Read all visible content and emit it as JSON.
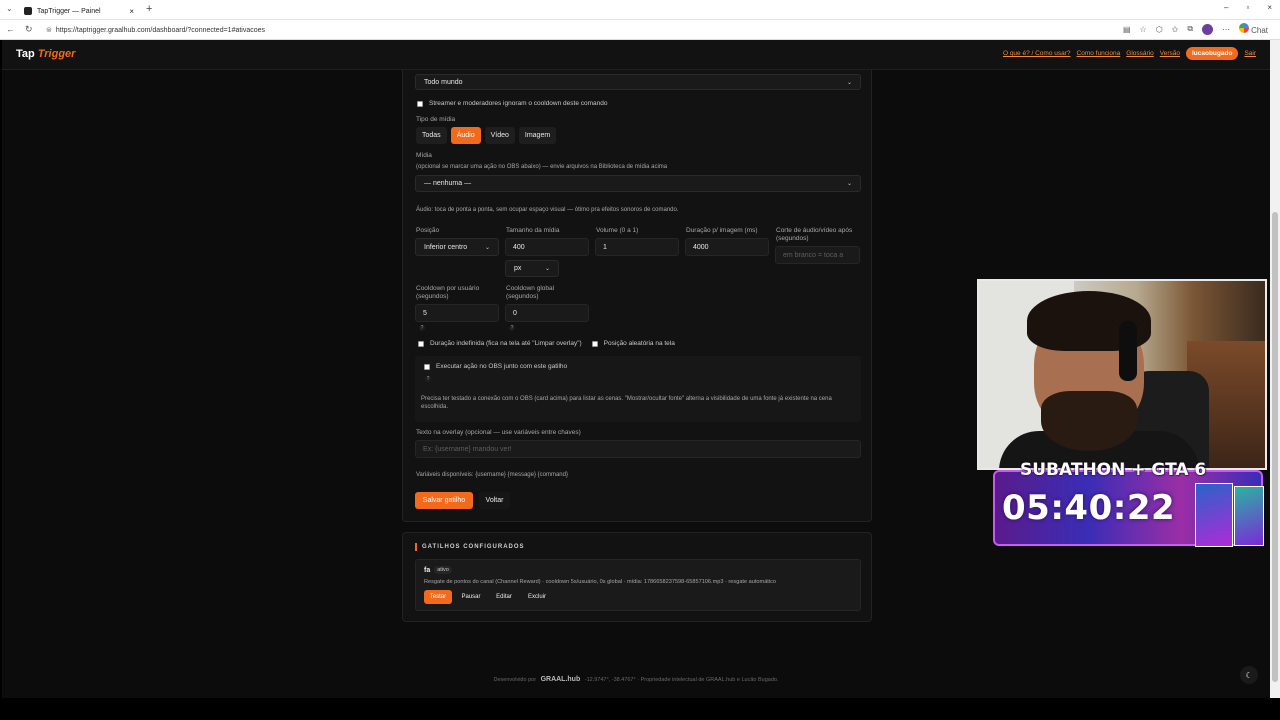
{
  "browser": {
    "tab_title": "TapTrigger — Painel",
    "tab_close": "×",
    "new_tab": "+",
    "url": "https://taptrigger.graalhub.com/dashboard/?connected=1#ativacoes",
    "chat_label": "Chat",
    "window_controls": [
      "–",
      "▫",
      "×"
    ]
  },
  "nav": {
    "logo_a": "Tap",
    "logo_b": "Trigger",
    "links": [
      "O que é? / Como usar?",
      "Como funciona",
      "Glossário",
      "Versão"
    ],
    "user": "lucaobugado",
    "logout": "Sair"
  },
  "form": {
    "audience_value": "Todo mundo",
    "ignore_cooldown_label": "Streamer e moderadores ignoram o cooldown deste comando",
    "media_type_label": "Tipo de mídia",
    "media_types": [
      "Todas",
      "Áudio",
      "Vídeo",
      "Imagem"
    ],
    "media_types_active": "Áudio",
    "media_label": "Mídia",
    "media_hint": "(opcional se marcar uma ação no OBS abaixo) — envie arquivos na Biblioteca de mídia acima",
    "media_value": "— nenhuma —",
    "audio_note": "Áudio: toca de ponta a ponta, sem ocupar espaço visual — ótimo pra efeitos sonoros de comando.",
    "position_label": "Posição",
    "position_value": "Inferior centro",
    "size_label": "Tamanho da mídia",
    "size_value": "400",
    "size_unit": "px",
    "volume_label": "Volume (0 a 1)",
    "volume_value": "1",
    "duration_label": "Duração p/ imagem (ms)",
    "duration_value": "4000",
    "cut_label": "Corte de áudio/vídeo após (segundos)",
    "cut_placeholder": "em branco = toca a",
    "user_cooldown_label": "Cooldown por usuário (segundos)",
    "user_cooldown_value": "5",
    "global_cooldown_label": "Cooldown global (segundos)",
    "global_cooldown_value": "0",
    "help": "?",
    "indefinite_label": "Duração indefinida (fica na tela até \"Limpar overlay\")",
    "random_pos_label": "Posição aleatória na tela",
    "obs_action_label": "Executar ação no OBS junto com este gatilho",
    "obs_hint": "Precisa ter testado a conexão com o OBS (card acima) para listar as cenas. \"Mostrar/ocultar fonte\" alterna a visibilidade de uma fonte já existente na cena escolhida.",
    "overlay_text_label": "Texto na overlay (opcional — use variáveis entre chaves)",
    "overlay_text_placeholder": "Ex: {username} mandou ver!",
    "vars_label": "Variáveis disponíveis: {username} {message} {command}",
    "save_label": "Salvar gatilho",
    "back_label": "Voltar"
  },
  "triggers": {
    "title": "GATILHOS CONFIGURADOS",
    "items": [
      {
        "name": "fa",
        "status": "ativo",
        "detail": "Resgate de pontos do canal (Channel Reward) · cooldown 5s/usuário, 0s global · mídia: 1786658237598-65857106.mp3 · resgate automático",
        "actions": [
          "Testar",
          "Pausar",
          "Editar",
          "Excluir"
        ]
      }
    ]
  },
  "footer": {
    "developed_by": "Desenvolvido por",
    "brand": "GRAAL.hub",
    "coords": "-12.9747°, -38.4767°",
    "rights": "Propriedade intelectual de GRAAL.hub e Lucão Bugado."
  },
  "stream_overlay": {
    "title": "SUBATHON + GTA 6",
    "timer": "05:40:22"
  },
  "colors": {
    "accent": "#f26a1b",
    "bg": "#0c0c0c",
    "card": "#121212"
  }
}
